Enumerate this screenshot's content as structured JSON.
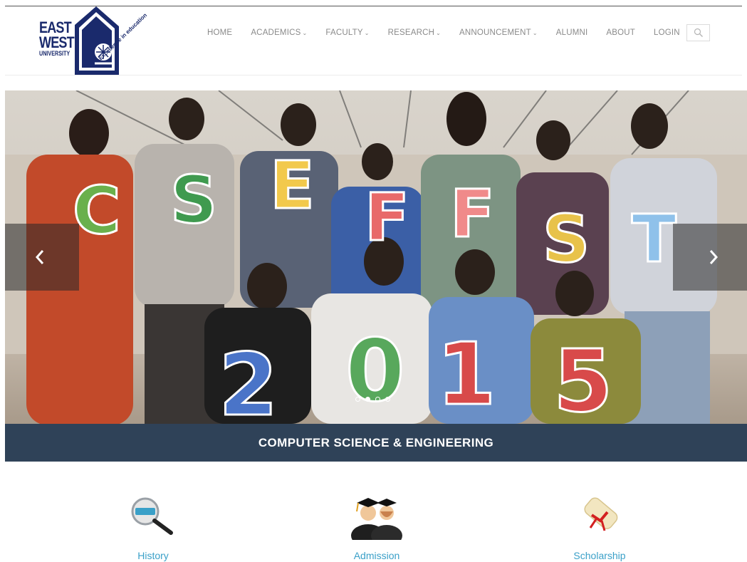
{
  "logo": {
    "line1": "EAST",
    "line2": "WEST",
    "line3": "UNIVERSITY",
    "tagline": "Excellence in education"
  },
  "nav": {
    "items": [
      {
        "label": "HOME",
        "dropdown": false
      },
      {
        "label": "ACADEMICS",
        "dropdown": true
      },
      {
        "label": "FACULTY",
        "dropdown": true
      },
      {
        "label": "RESEARCH",
        "dropdown": true
      },
      {
        "label": "ANNOUNCEMENT",
        "dropdown": true
      },
      {
        "label": "ALUMNI",
        "dropdown": false
      },
      {
        "label": "ABOUT",
        "dropdown": false
      },
      {
        "label": "LOGIN",
        "dropdown": false
      }
    ],
    "search_icon": "search-icon"
  },
  "slider": {
    "letters_top": [
      "C",
      "S",
      "E",
      "F",
      "F",
      "S",
      "T"
    ],
    "letters_bottom": [
      "2",
      "0",
      "1",
      "5"
    ],
    "caption": "COMPUTER SCIENCE & ENGINEERING",
    "prev_icon": "chevron-left-icon",
    "next_icon": "chevron-right-icon",
    "slide_count": 4,
    "active_slide": 2
  },
  "features": [
    {
      "label": "History",
      "icon": "history-magnifier-icon"
    },
    {
      "label": "Admission",
      "icon": "graduates-icon"
    },
    {
      "label": "Scholarship",
      "icon": "diploma-scroll-icon"
    }
  ],
  "colors": {
    "brand_navy": "#1a2a6c",
    "caption_bar": "#2f4258",
    "feature_link": "#3aa0c8",
    "nav_text": "#8a8a8a"
  }
}
